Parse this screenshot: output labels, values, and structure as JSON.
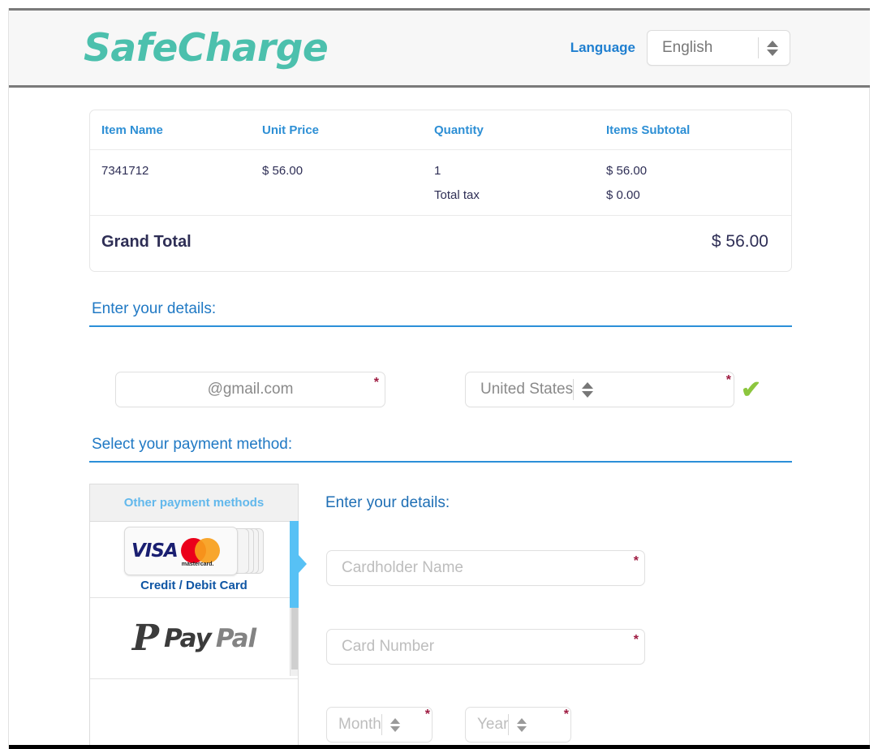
{
  "header": {
    "logo_text": "SafeCharge",
    "logo_color": "#4cc0ad",
    "language_label": "Language",
    "language_value": "English"
  },
  "order_summary": {
    "columns": [
      "Item Name",
      "Unit Price",
      "Quantity",
      "Items Subtotal"
    ],
    "item": {
      "name": "7341712",
      "unit_price": "$ 56.00",
      "quantity": "1",
      "subtotal": "$ 56.00"
    },
    "tax_label": "Total tax",
    "tax_value": "$ 0.00",
    "grand_total_label": "Grand Total",
    "grand_total_value": "$ 56.00"
  },
  "details_section": {
    "heading": "Enter your details:",
    "email_value": "@gmail.com",
    "email_required": "*",
    "country_value": "United States",
    "country_required": "*",
    "country_valid_icon": "✔"
  },
  "payment_section": {
    "heading": "Select your payment method:",
    "panel_title": "Other payment methods",
    "methods": [
      {
        "id": "credit-debit-card",
        "label": "Credit / Debit Card",
        "selected": true,
        "brands": [
          "VISA",
          "mastercard"
        ]
      },
      {
        "id": "paypal",
        "label": "PayPal",
        "selected": false,
        "brands": [
          "PayPal"
        ]
      }
    ],
    "visa_text": "VISA",
    "mastercard_text": "mastercard.",
    "paypal_mark": "P",
    "paypal_pay": "Pay",
    "paypal_pal": "Pal"
  },
  "card_form": {
    "heading": "Enter your details:",
    "cardholder_placeholder": "Cardholder Name",
    "cardholder_required": "*",
    "card_number_placeholder": "Card Number",
    "card_number_required": "*",
    "month_placeholder": "Month",
    "month_required": "*",
    "year_placeholder": "Year",
    "year_required": "*"
  },
  "colors": {
    "brand_teal": "#4cc0ad",
    "link_blue": "#2079c4",
    "header_blue": "#2d8fd5",
    "select_bar_blue": "#57c1f5",
    "required_red": "#9e1b41",
    "valid_green": "#8cc63e",
    "text_navy": "#2e2e55"
  }
}
